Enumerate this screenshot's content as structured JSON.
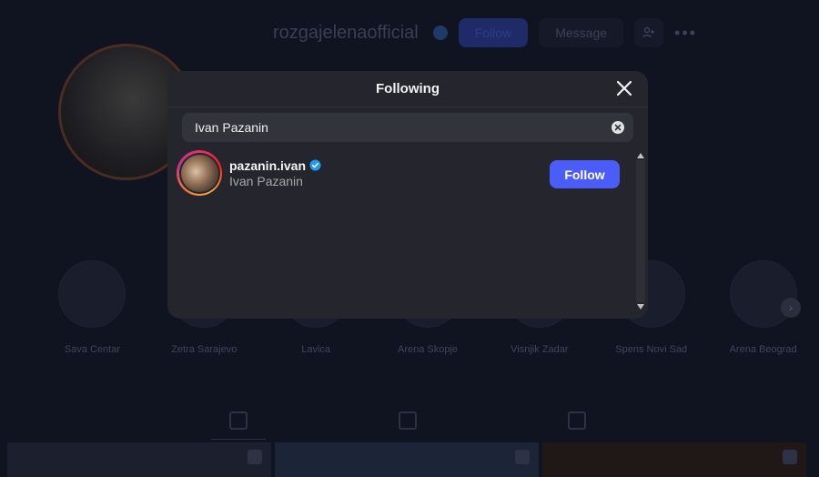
{
  "profile": {
    "username": "rozgajelenaofficial",
    "follow_label": "Follow",
    "message_label": "Message",
    "highlights": [
      {
        "label": "Sava Centar"
      },
      {
        "label": "Zetra Sarajevo"
      },
      {
        "label": "Lavica"
      },
      {
        "label": "Arena Skopje"
      },
      {
        "label": "Visnjik Zadar"
      },
      {
        "label": "Spens Novi Sad"
      },
      {
        "label": "Arena Beograd"
      }
    ]
  },
  "modal": {
    "title": "Following",
    "search": {
      "value": "Ivan Pazanin",
      "placeholder": "Search"
    },
    "results": [
      {
        "username": "pazanin.ivan",
        "full_name": "Ivan Pazanin",
        "verified": true,
        "button_label": "Follow"
      }
    ]
  },
  "colors": {
    "accent": "#4a5df9",
    "modal_bg": "#25262d",
    "verified": "#1d9bf0"
  }
}
